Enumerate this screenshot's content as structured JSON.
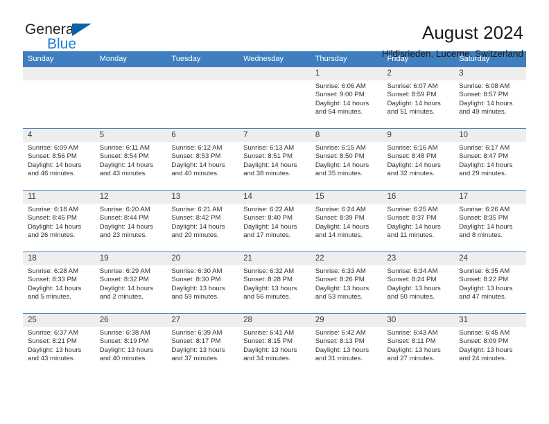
{
  "logo": {
    "part1": "General",
    "part2": "Blue",
    "triangle_color": "#0b63ad",
    "text_color": "#231f20",
    "blue_color": "#1b7fd4"
  },
  "header": {
    "title": "August 2024",
    "subtitle": "Hildisrieden, Lucerne, Switzerland"
  },
  "theme": {
    "header_row_bg": "#3f7fbf",
    "header_row_text": "#ffffff",
    "daynum_bg": "#eeeeee",
    "row_divider": "#4a85c0"
  },
  "weekdays": [
    "Sunday",
    "Monday",
    "Tuesday",
    "Wednesday",
    "Thursday",
    "Friday",
    "Saturday"
  ],
  "weeks": [
    [
      {
        "day": "",
        "empty": true
      },
      {
        "day": "",
        "empty": true
      },
      {
        "day": "",
        "empty": true
      },
      {
        "day": "",
        "empty": true
      },
      {
        "day": "1",
        "sunrise": "Sunrise: 6:06 AM",
        "sunset": "Sunset: 9:00 PM",
        "daylight1": "Daylight: 14 hours",
        "daylight2": "and 54 minutes."
      },
      {
        "day": "2",
        "sunrise": "Sunrise: 6:07 AM",
        "sunset": "Sunset: 8:59 PM",
        "daylight1": "Daylight: 14 hours",
        "daylight2": "and 51 minutes."
      },
      {
        "day": "3",
        "sunrise": "Sunrise: 6:08 AM",
        "sunset": "Sunset: 8:57 PM",
        "daylight1": "Daylight: 14 hours",
        "daylight2": "and 49 minutes."
      }
    ],
    [
      {
        "day": "4",
        "sunrise": "Sunrise: 6:09 AM",
        "sunset": "Sunset: 8:56 PM",
        "daylight1": "Daylight: 14 hours",
        "daylight2": "and 46 minutes."
      },
      {
        "day": "5",
        "sunrise": "Sunrise: 6:11 AM",
        "sunset": "Sunset: 8:54 PM",
        "daylight1": "Daylight: 14 hours",
        "daylight2": "and 43 minutes."
      },
      {
        "day": "6",
        "sunrise": "Sunrise: 6:12 AM",
        "sunset": "Sunset: 8:53 PM",
        "daylight1": "Daylight: 14 hours",
        "daylight2": "and 40 minutes."
      },
      {
        "day": "7",
        "sunrise": "Sunrise: 6:13 AM",
        "sunset": "Sunset: 8:51 PM",
        "daylight1": "Daylight: 14 hours",
        "daylight2": "and 38 minutes."
      },
      {
        "day": "8",
        "sunrise": "Sunrise: 6:15 AM",
        "sunset": "Sunset: 8:50 PM",
        "daylight1": "Daylight: 14 hours",
        "daylight2": "and 35 minutes."
      },
      {
        "day": "9",
        "sunrise": "Sunrise: 6:16 AM",
        "sunset": "Sunset: 8:48 PM",
        "daylight1": "Daylight: 14 hours",
        "daylight2": "and 32 minutes."
      },
      {
        "day": "10",
        "sunrise": "Sunrise: 6:17 AM",
        "sunset": "Sunset: 8:47 PM",
        "daylight1": "Daylight: 14 hours",
        "daylight2": "and 29 minutes."
      }
    ],
    [
      {
        "day": "11",
        "sunrise": "Sunrise: 6:18 AM",
        "sunset": "Sunset: 8:45 PM",
        "daylight1": "Daylight: 14 hours",
        "daylight2": "and 26 minutes."
      },
      {
        "day": "12",
        "sunrise": "Sunrise: 6:20 AM",
        "sunset": "Sunset: 8:44 PM",
        "daylight1": "Daylight: 14 hours",
        "daylight2": "and 23 minutes."
      },
      {
        "day": "13",
        "sunrise": "Sunrise: 6:21 AM",
        "sunset": "Sunset: 8:42 PM",
        "daylight1": "Daylight: 14 hours",
        "daylight2": "and 20 minutes."
      },
      {
        "day": "14",
        "sunrise": "Sunrise: 6:22 AM",
        "sunset": "Sunset: 8:40 PM",
        "daylight1": "Daylight: 14 hours",
        "daylight2": "and 17 minutes."
      },
      {
        "day": "15",
        "sunrise": "Sunrise: 6:24 AM",
        "sunset": "Sunset: 8:39 PM",
        "daylight1": "Daylight: 14 hours",
        "daylight2": "and 14 minutes."
      },
      {
        "day": "16",
        "sunrise": "Sunrise: 6:25 AM",
        "sunset": "Sunset: 8:37 PM",
        "daylight1": "Daylight: 14 hours",
        "daylight2": "and 11 minutes."
      },
      {
        "day": "17",
        "sunrise": "Sunrise: 6:26 AM",
        "sunset": "Sunset: 8:35 PM",
        "daylight1": "Daylight: 14 hours",
        "daylight2": "and 8 minutes."
      }
    ],
    [
      {
        "day": "18",
        "sunrise": "Sunrise: 6:28 AM",
        "sunset": "Sunset: 8:33 PM",
        "daylight1": "Daylight: 14 hours",
        "daylight2": "and 5 minutes."
      },
      {
        "day": "19",
        "sunrise": "Sunrise: 6:29 AM",
        "sunset": "Sunset: 8:32 PM",
        "daylight1": "Daylight: 14 hours",
        "daylight2": "and 2 minutes."
      },
      {
        "day": "20",
        "sunrise": "Sunrise: 6:30 AM",
        "sunset": "Sunset: 8:30 PM",
        "daylight1": "Daylight: 13 hours",
        "daylight2": "and 59 minutes."
      },
      {
        "day": "21",
        "sunrise": "Sunrise: 6:32 AM",
        "sunset": "Sunset: 8:28 PM",
        "daylight1": "Daylight: 13 hours",
        "daylight2": "and 56 minutes."
      },
      {
        "day": "22",
        "sunrise": "Sunrise: 6:33 AM",
        "sunset": "Sunset: 8:26 PM",
        "daylight1": "Daylight: 13 hours",
        "daylight2": "and 53 minutes."
      },
      {
        "day": "23",
        "sunrise": "Sunrise: 6:34 AM",
        "sunset": "Sunset: 8:24 PM",
        "daylight1": "Daylight: 13 hours",
        "daylight2": "and 50 minutes."
      },
      {
        "day": "24",
        "sunrise": "Sunrise: 6:35 AM",
        "sunset": "Sunset: 8:22 PM",
        "daylight1": "Daylight: 13 hours",
        "daylight2": "and 47 minutes."
      }
    ],
    [
      {
        "day": "25",
        "sunrise": "Sunrise: 6:37 AM",
        "sunset": "Sunset: 8:21 PM",
        "daylight1": "Daylight: 13 hours",
        "daylight2": "and 43 minutes."
      },
      {
        "day": "26",
        "sunrise": "Sunrise: 6:38 AM",
        "sunset": "Sunset: 8:19 PM",
        "daylight1": "Daylight: 13 hours",
        "daylight2": "and 40 minutes."
      },
      {
        "day": "27",
        "sunrise": "Sunrise: 6:39 AM",
        "sunset": "Sunset: 8:17 PM",
        "daylight1": "Daylight: 13 hours",
        "daylight2": "and 37 minutes."
      },
      {
        "day": "28",
        "sunrise": "Sunrise: 6:41 AM",
        "sunset": "Sunset: 8:15 PM",
        "daylight1": "Daylight: 13 hours",
        "daylight2": "and 34 minutes."
      },
      {
        "day": "29",
        "sunrise": "Sunrise: 6:42 AM",
        "sunset": "Sunset: 8:13 PM",
        "daylight1": "Daylight: 13 hours",
        "daylight2": "and 31 minutes."
      },
      {
        "day": "30",
        "sunrise": "Sunrise: 6:43 AM",
        "sunset": "Sunset: 8:11 PM",
        "daylight1": "Daylight: 13 hours",
        "daylight2": "and 27 minutes."
      },
      {
        "day": "31",
        "sunrise": "Sunrise: 6:45 AM",
        "sunset": "Sunset: 8:09 PM",
        "daylight1": "Daylight: 13 hours",
        "daylight2": "and 24 minutes."
      }
    ]
  ]
}
